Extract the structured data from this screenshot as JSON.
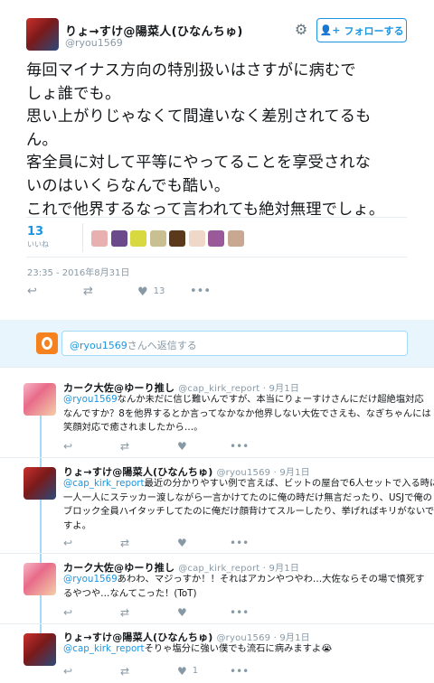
{
  "main_tweet": {
    "display_name": "りょ→すけ@陽菜人(ひなんちゅ)",
    "handle": "@ryou1569",
    "follow_label": "フォローする",
    "text_lines": [
      "毎回マイナス方向の特別扱いはさすがに病むで",
      "しょ誰でも。",
      "思い上がりじゃなくて間違いなく差別されてるも",
      "ん。",
      "客全員に対して平等にやってることを享受されな",
      "いのはいくらなんでも酷い。",
      "これで他界するなって言われても絶対無理でしょ。"
    ],
    "likes_count": "13",
    "likes_label": "いいね",
    "timestamp": "23:35 - 2016年8月31日",
    "like_action_count": "13",
    "liker_colors": [
      "#e8b0b0",
      "#6a4a8a",
      "#d8d840",
      "#c8c090",
      "#5a3a1a",
      "#f0d8c8",
      "#9a5a9a",
      "#c8a890"
    ]
  },
  "reply_box": {
    "handle": "@ryou1569",
    "placeholder_suffix": "さんへ返信する"
  },
  "replies": [
    {
      "name": "カーク大佐@ゆーり推し",
      "meta": "@cap_kirk_report · 9月1日",
      "mention": "@ryou1569",
      "lines": [
        "なんか未だに信じ難いんですが、本当にりょーすけさんにだけ超絶塩対応",
        "なんですか？8を他界するとか言ってなかなか他界しない大佐でさえも、なぎちゃんには",
        "笑顔対応で癒されましたから…。"
      ],
      "like_count": ""
    },
    {
      "name": "りょ→すけ@陽菜人(ひなんちゅ)",
      "meta": "@ryou1569 · 9月1日",
      "mention": "@cap_kirk_report",
      "lines": [
        "最近の分かりやすい例で言えば、ビットの屋台で6人セットで入る時に",
        "一人一人にステッカー渡しながら一言かけてたのに俺の時だけ無言だったり、USJで俺の",
        "ブロック全員ハイタッチしてたのに俺だけ顔背けてスルーしたり、挙げればキリがないで",
        "すよ。"
      ],
      "like_count": ""
    },
    {
      "name": "カーク大佐@ゆーり推し",
      "meta": "@cap_kirk_report · 9月1日",
      "mention": "@ryou1569",
      "lines": [
        "あわわ、マジっすか！！それはアカンやつやわ…大佐ならその場で憤死す",
        "るやつや…なんてこった！(ToT)"
      ],
      "like_count": ""
    },
    {
      "name": "りょ→すけ@陽菜人(ひなんちゅ)",
      "meta": "@ryou1569 · 9月1日",
      "mention": "@cap_kirk_report",
      "lines": [
        "そりゃ塩分に強い僕でも流石に病みますよ😭"
      ],
      "like_count": "1"
    }
  ],
  "icons": {
    "gear": "gear-icon",
    "reply": "reply-icon",
    "retweet": "retweet-icon",
    "like": "heart-icon",
    "more": "more-icon"
  },
  "colors": {
    "accent": "#1b95e0",
    "muted": "#8899a6",
    "reply_bg": "#e8f5fd",
    "thread_line": "#a4d9f9"
  }
}
